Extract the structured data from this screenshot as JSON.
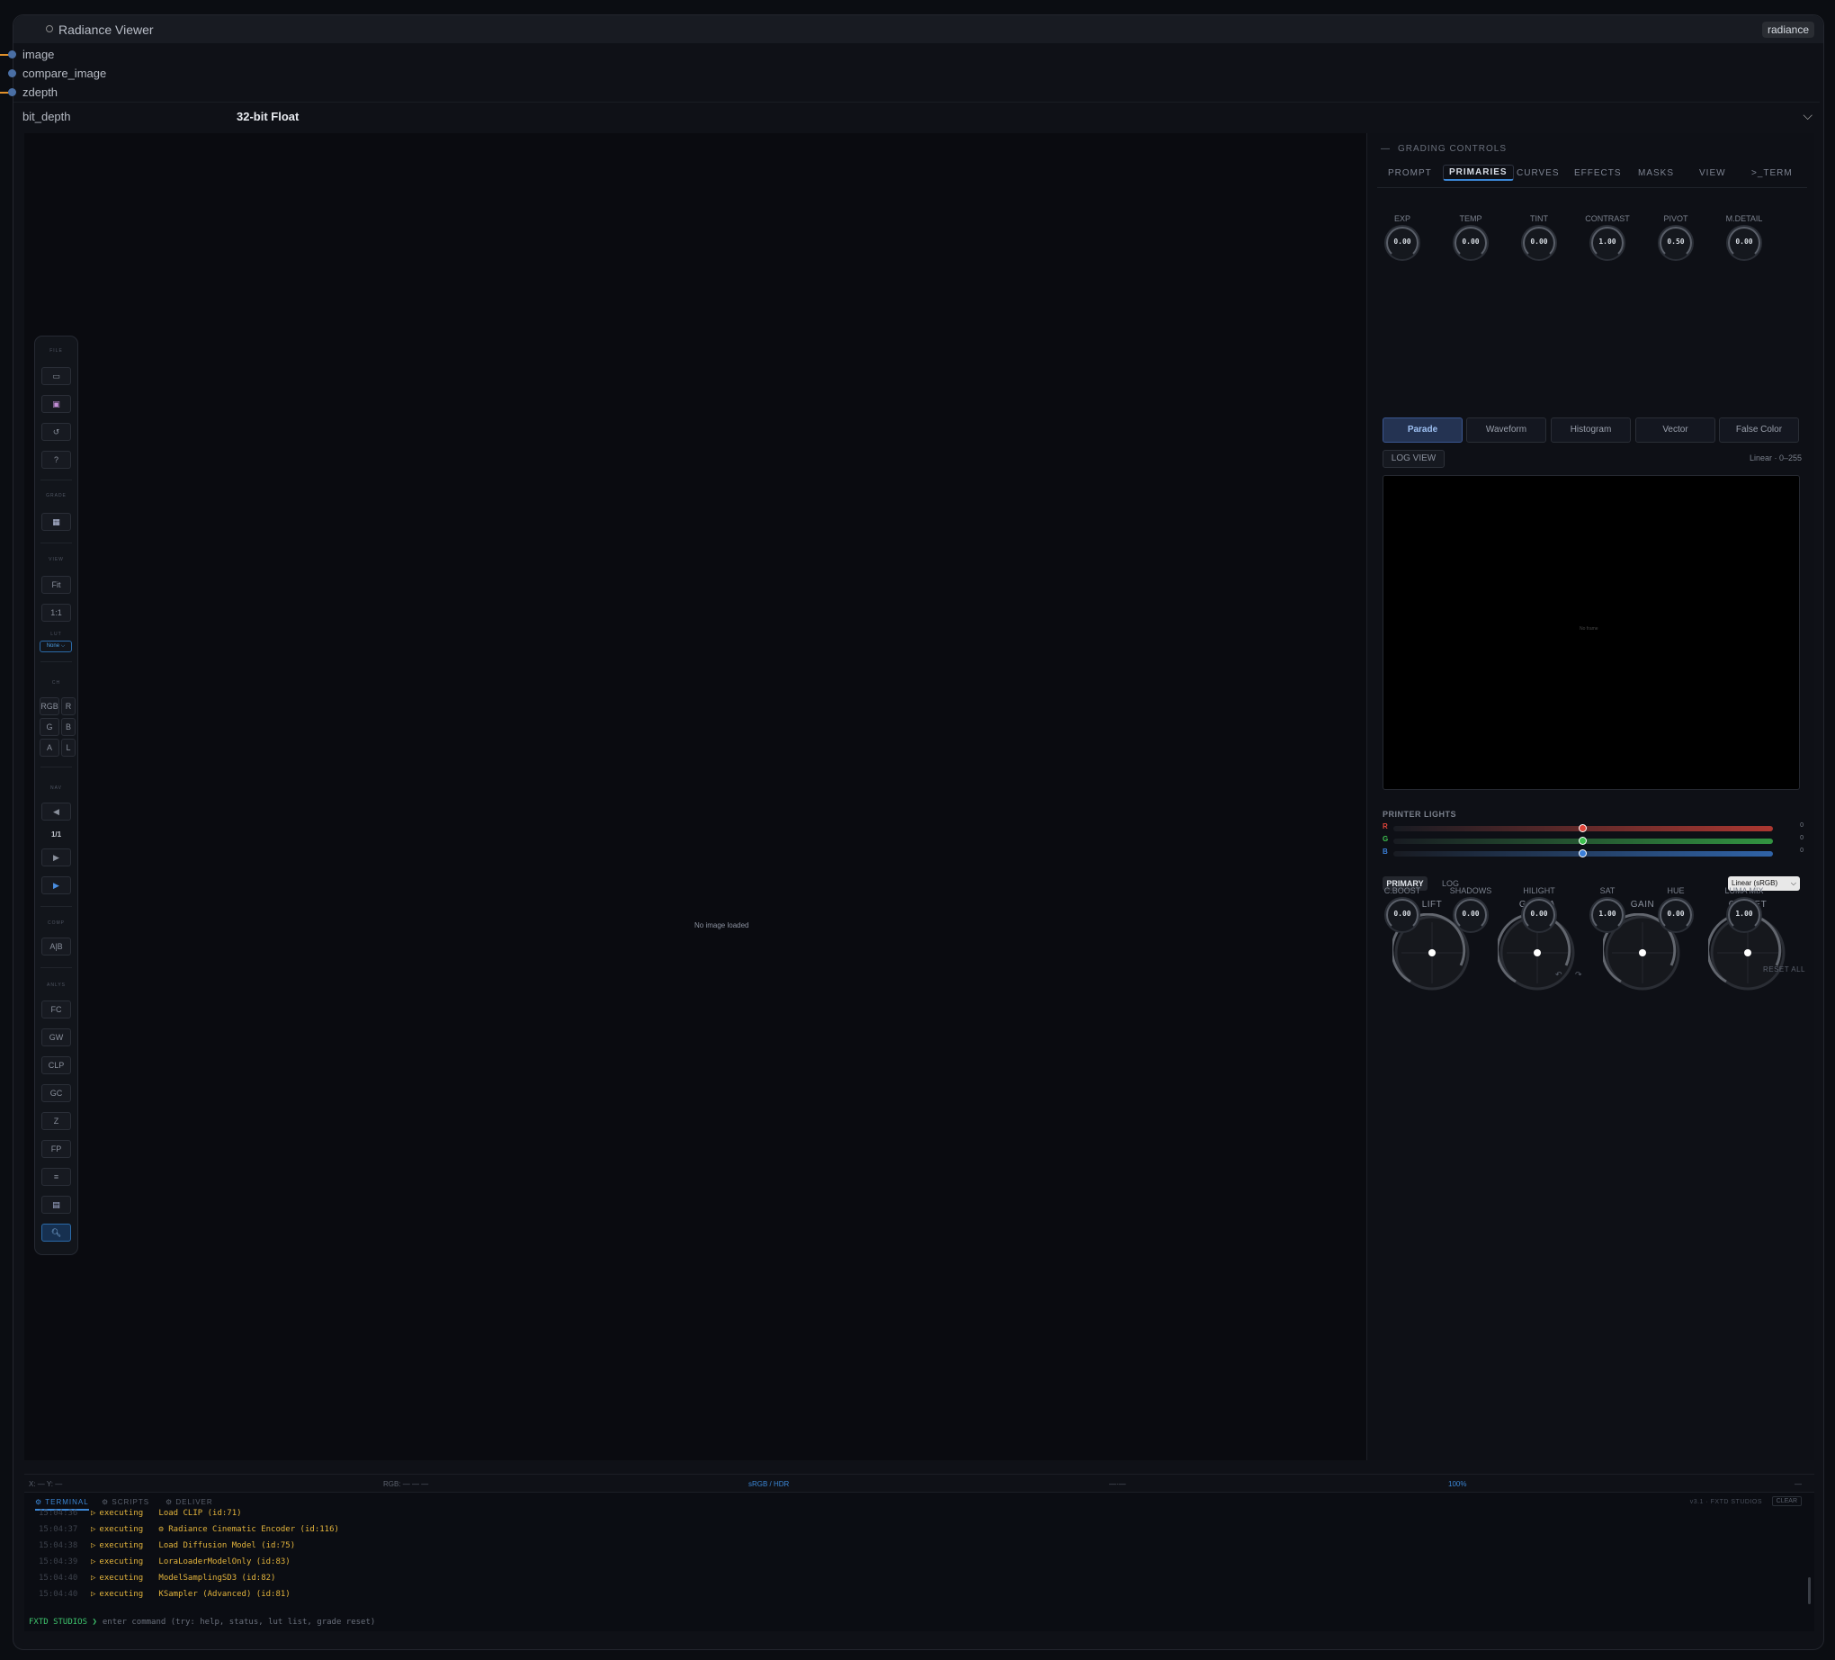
{
  "node": {
    "title": "Radiance Viewer",
    "badge": "radiance"
  },
  "inputs": [
    "image",
    "compare_image",
    "zdepth"
  ],
  "bit_depth": {
    "label": "bit_depth",
    "value": "32-bit Float"
  },
  "viewer": {
    "empty_message": "No image loaded"
  },
  "toolbar": {
    "sections": [
      "FILE",
      "GRADE",
      "VIEW",
      "LUT",
      "CH",
      "NAV",
      "COMP",
      "ANLYS"
    ],
    "buttons": {
      "fit": "Fit",
      "one_to_one": "1:1",
      "lut_select": "None",
      "rgb": "RGB",
      "r": "R",
      "g": "G",
      "b": "B",
      "a": "A",
      "l": "L",
      "frame": "1/1",
      "ab": "A|B",
      "fc": "FC",
      "gw": "GW",
      "clp": "CLP",
      "gc": "GC",
      "z": "Z",
      "fp": "FP"
    }
  },
  "panel": {
    "title": "GRADING CONTROLS",
    "tabs": [
      "PROMPT",
      "PRIMARIES",
      "CURVES",
      "EFFECTS",
      "MASKS",
      "VIEW",
      ">_TERM"
    ],
    "active_tab": "PRIMARIES",
    "knobs_top": [
      {
        "label": "EXP",
        "value": "0.00"
      },
      {
        "label": "TEMP",
        "value": "0.00"
      },
      {
        "label": "TINT",
        "value": "0.00"
      },
      {
        "label": "CONTRAST",
        "value": "1.00"
      },
      {
        "label": "PIVOT",
        "value": "0.50"
      },
      {
        "label": "M.DETAIL",
        "value": "0.00"
      }
    ],
    "scopes": [
      "Parade",
      "Waveform",
      "Histogram",
      "Vector",
      "False Color"
    ],
    "active_scope": "Parade",
    "log_view": "LOG VIEW",
    "scope_range": "Linear · 0–255",
    "scope_message": "No frame",
    "printer_lights": {
      "title": "PRINTER LIGHTS",
      "channels": [
        {
          "label": "R",
          "value": "0",
          "color": "#e0453a",
          "level": 0.5
        },
        {
          "label": "G",
          "value": "0",
          "color": "#3ec04f",
          "level": 0.5
        },
        {
          "label": "B",
          "value": "0",
          "color": "#3b7fd8",
          "level": 0.5
        }
      ]
    },
    "modes": {
      "primary": "PRIMARY",
      "log": "LOG"
    },
    "colorspace": "Linear (sRGB)",
    "wheels": [
      "LIFT",
      "GAMMA",
      "GAIN",
      "OFFSET"
    ],
    "knobs_bottom": [
      {
        "label": "C.BOOST",
        "value": "0.00"
      },
      {
        "label": "SHADOWS",
        "value": "0.00"
      },
      {
        "label": "HILIGHT",
        "value": "0.00"
      },
      {
        "label": "SAT",
        "value": "1.00"
      },
      {
        "label": "HUE",
        "value": "0.00"
      },
      {
        "label": "LUMA MIX",
        "value": "1.00"
      }
    ],
    "reset_all": "RESET ALL"
  },
  "status_bar": {
    "xy": "X: — Y: —",
    "rgb": "RGB: — — —",
    "colorspace": "sRGB / HDR",
    "mid": "—·—",
    "zoom": "100%",
    "right": "—"
  },
  "terminal": {
    "tabs": [
      "TERMINAL",
      "SCRIPTS",
      "DELIVER"
    ],
    "active_tab": "TERMINAL",
    "version": "v3.1 · FXTD STUDIOS",
    "clear": "CLEAR",
    "logs": [
      {
        "ts": "15:04:36",
        "status": "executing",
        "msg": "Load CLIP  (id:71)"
      },
      {
        "ts": "15:04:37",
        "status": "executing",
        "msg": "⚙ Radiance Cinematic Encoder  (id:116)"
      },
      {
        "ts": "15:04:38",
        "status": "executing",
        "msg": "Load Diffusion Model  (id:75)"
      },
      {
        "ts": "15:04:39",
        "status": "executing",
        "msg": "LoraLoaderModelOnly  (id:83)"
      },
      {
        "ts": "15:04:40",
        "status": "executing",
        "msg": "ModelSamplingSD3  (id:82)"
      },
      {
        "ts": "15:04:40",
        "status": "executing",
        "msg": "KSampler (Advanced)  (id:81)"
      }
    ],
    "prompt_label": "FXTD STUDIOS ❯",
    "placeholder": "enter command (try: help, status, lut list, grade reset)"
  }
}
